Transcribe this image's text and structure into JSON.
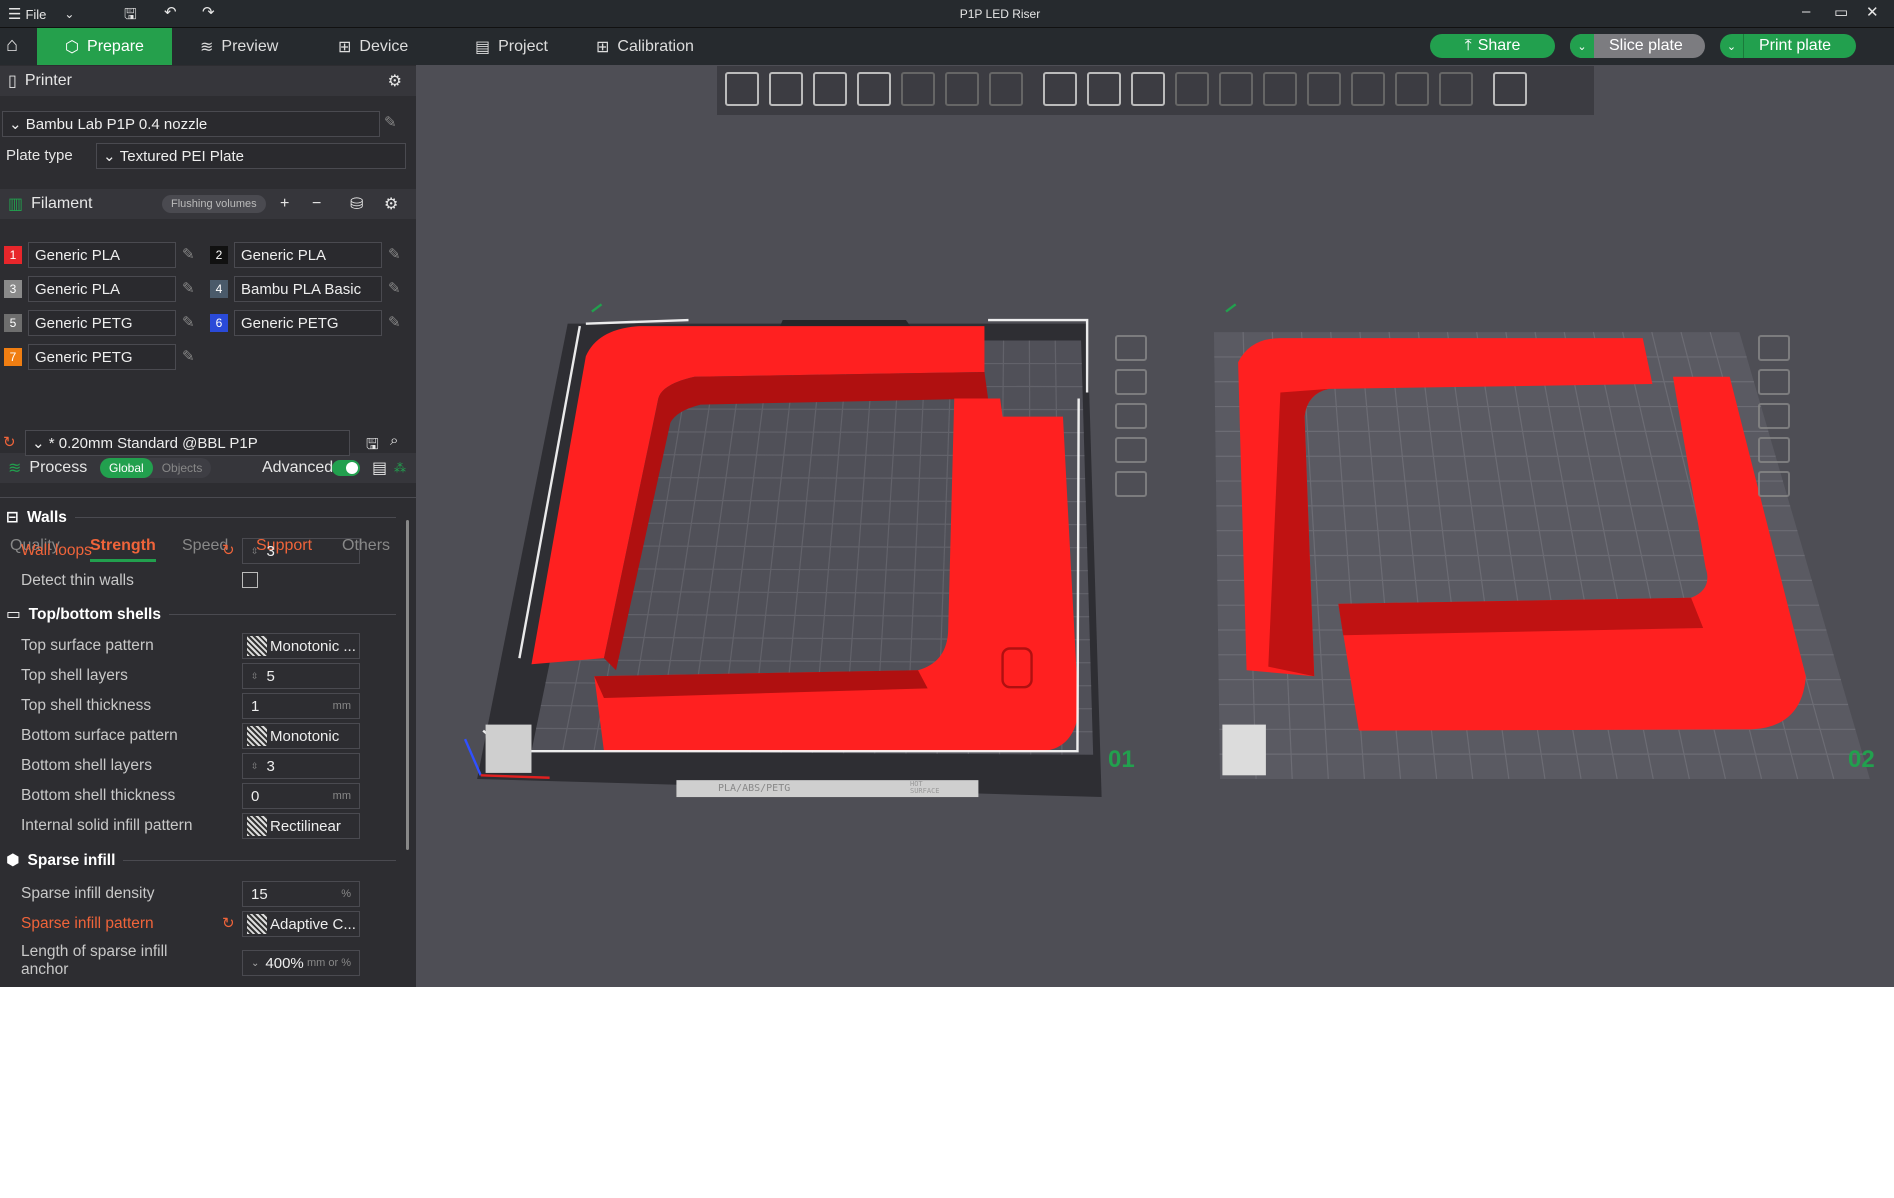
{
  "window": {
    "title": "P1P LED Riser",
    "file_menu": "File"
  },
  "tabs": [
    {
      "label": "Prepare",
      "icon": "cube-icon"
    },
    {
      "label": "Preview",
      "icon": "layers-icon"
    },
    {
      "label": "Device",
      "icon": "device-icon"
    },
    {
      "label": "Project",
      "icon": "project-icon"
    },
    {
      "label": "Calibration",
      "icon": "calibration-icon"
    }
  ],
  "actions": {
    "share": "Share",
    "slice": "Slice plate",
    "print": "Print plate"
  },
  "printer": {
    "header": "Printer",
    "name": "Bambu Lab P1P 0.4 nozzle",
    "plate_type_label": "Plate type",
    "plate_type": "Textured PEI Plate"
  },
  "filament": {
    "header": "Filament",
    "flushing": "Flushing volumes",
    "items": [
      {
        "n": "1",
        "name": "Generic PLA",
        "color": "#e8262b"
      },
      {
        "n": "2",
        "name": "Generic PLA",
        "color": "#111111"
      },
      {
        "n": "3",
        "name": "Generic PLA",
        "color": "#8a8a8a"
      },
      {
        "n": "4",
        "name": "Bambu PLA Basic",
        "color": "#4a5a6a"
      },
      {
        "n": "5",
        "name": "Generic PETG",
        "color": "#6e6e6e"
      },
      {
        "n": "6",
        "name": "Generic PETG",
        "color": "#2a4ad8"
      },
      {
        "n": "7",
        "name": "Generic PETG",
        "color": "#f07e12"
      }
    ]
  },
  "process": {
    "header": "Process",
    "global": "Global",
    "objects": "Objects",
    "advanced": "Advanced",
    "advanced_on": true,
    "preset": "* 0.20mm Standard @BBL P1P",
    "tabs": [
      "Quality",
      "Strength",
      "Speed",
      "Support",
      "Others"
    ],
    "active_tab": "Strength",
    "walls": {
      "title": "Walls",
      "wall_loops_label": "Wall loops",
      "wall_loops": "3",
      "detect_thin_label": "Detect thin walls",
      "detect_thin": false
    },
    "shells": {
      "title": "Top/bottom shells",
      "top_pattern_label": "Top surface pattern",
      "top_pattern": "Monotonic ...",
      "top_layers_label": "Top shell layers",
      "top_layers": "5",
      "top_thick_label": "Top shell thickness",
      "top_thick": "1",
      "bottom_pattern_label": "Bottom surface pattern",
      "bottom_pattern": "Monotonic",
      "bottom_layers_label": "Bottom shell layers",
      "bottom_layers": "3",
      "bottom_thick_label": "Bottom shell thickness",
      "bottom_thick": "0",
      "internal_label": "Internal solid infill pattern",
      "internal": "Rectilinear",
      "unit_mm": "mm"
    },
    "sparse": {
      "title": "Sparse infill",
      "density_label": "Sparse infill density",
      "density": "15",
      "density_unit": "%",
      "pattern_label": "Sparse infill pattern",
      "pattern": "Adaptive C...",
      "anchor_label": "Length of sparse infill anchor",
      "anchor": "400%",
      "anchor_unit": "mm or %"
    }
  },
  "viewport": {
    "plates": [
      {
        "label": "01"
      },
      {
        "label": "02"
      }
    ],
    "plate_text": "PLA/ABS/PETG",
    "hot_surface": "HOT SURFACE",
    "model_color": "#ff2020",
    "accent": "#22a04e"
  }
}
